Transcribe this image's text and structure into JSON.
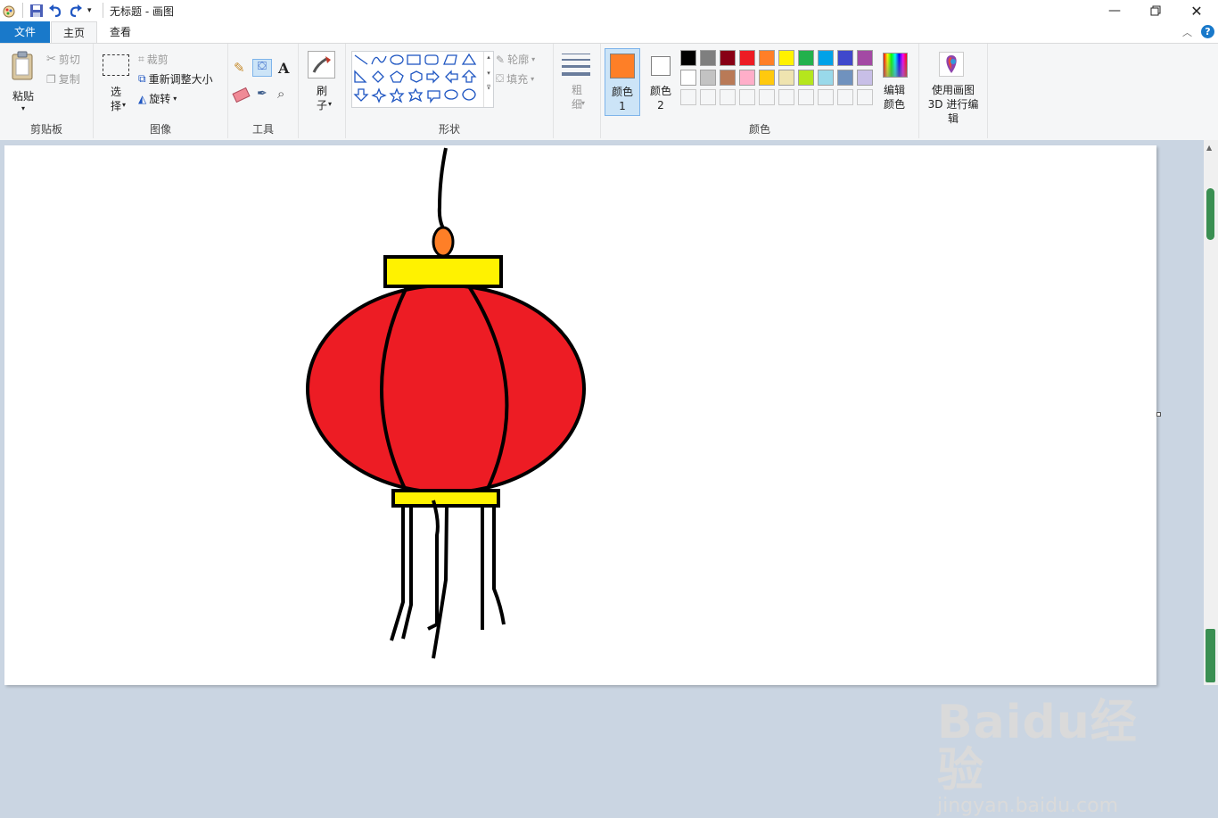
{
  "window": {
    "title": "无标题 - 画图"
  },
  "tabs": [
    {
      "label": "文件"
    },
    {
      "label": "主页"
    },
    {
      "label": "查看"
    }
  ],
  "clipboard": {
    "paste": "粘贴",
    "cut": "剪切",
    "copy": "复制",
    "group": "剪贴板"
  },
  "image": {
    "select": "选择",
    "crop": "裁剪",
    "resize": "重新调整大小",
    "rotate": "旋转",
    "group": "图像"
  },
  "tools": {
    "group": "工具"
  },
  "brushes": {
    "label": "刷子"
  },
  "shapes": {
    "outline": "轮廓",
    "fill": "填充",
    "group": "形状"
  },
  "size": {
    "label": "粗细"
  },
  "colors": {
    "color1_label": "颜色 1",
    "color2_label": "颜色 2",
    "edit_label": "编辑颜色",
    "group": "颜色",
    "color1": "#fe7f27",
    "color2": "#ffffff",
    "palette": [
      "#000000",
      "#7f7f7f",
      "#880015",
      "#ed1c24",
      "#ff7f27",
      "#fff200",
      "#22b14c",
      "#00a2e8",
      "#3f48cc",
      "#a349a4",
      "#ffffff",
      "#c3c3c3",
      "#b97a57",
      "#ffaec9",
      "#ffc90e",
      "#efe4b0",
      "#b5e61d",
      "#99d9ea",
      "#7092be",
      "#c8bfe7"
    ]
  },
  "paint3d": {
    "label": "使用画图 3D 进行编辑"
  },
  "watermark": {
    "logo": "Baidu经验",
    "url": "jingyan.baidu.com"
  }
}
